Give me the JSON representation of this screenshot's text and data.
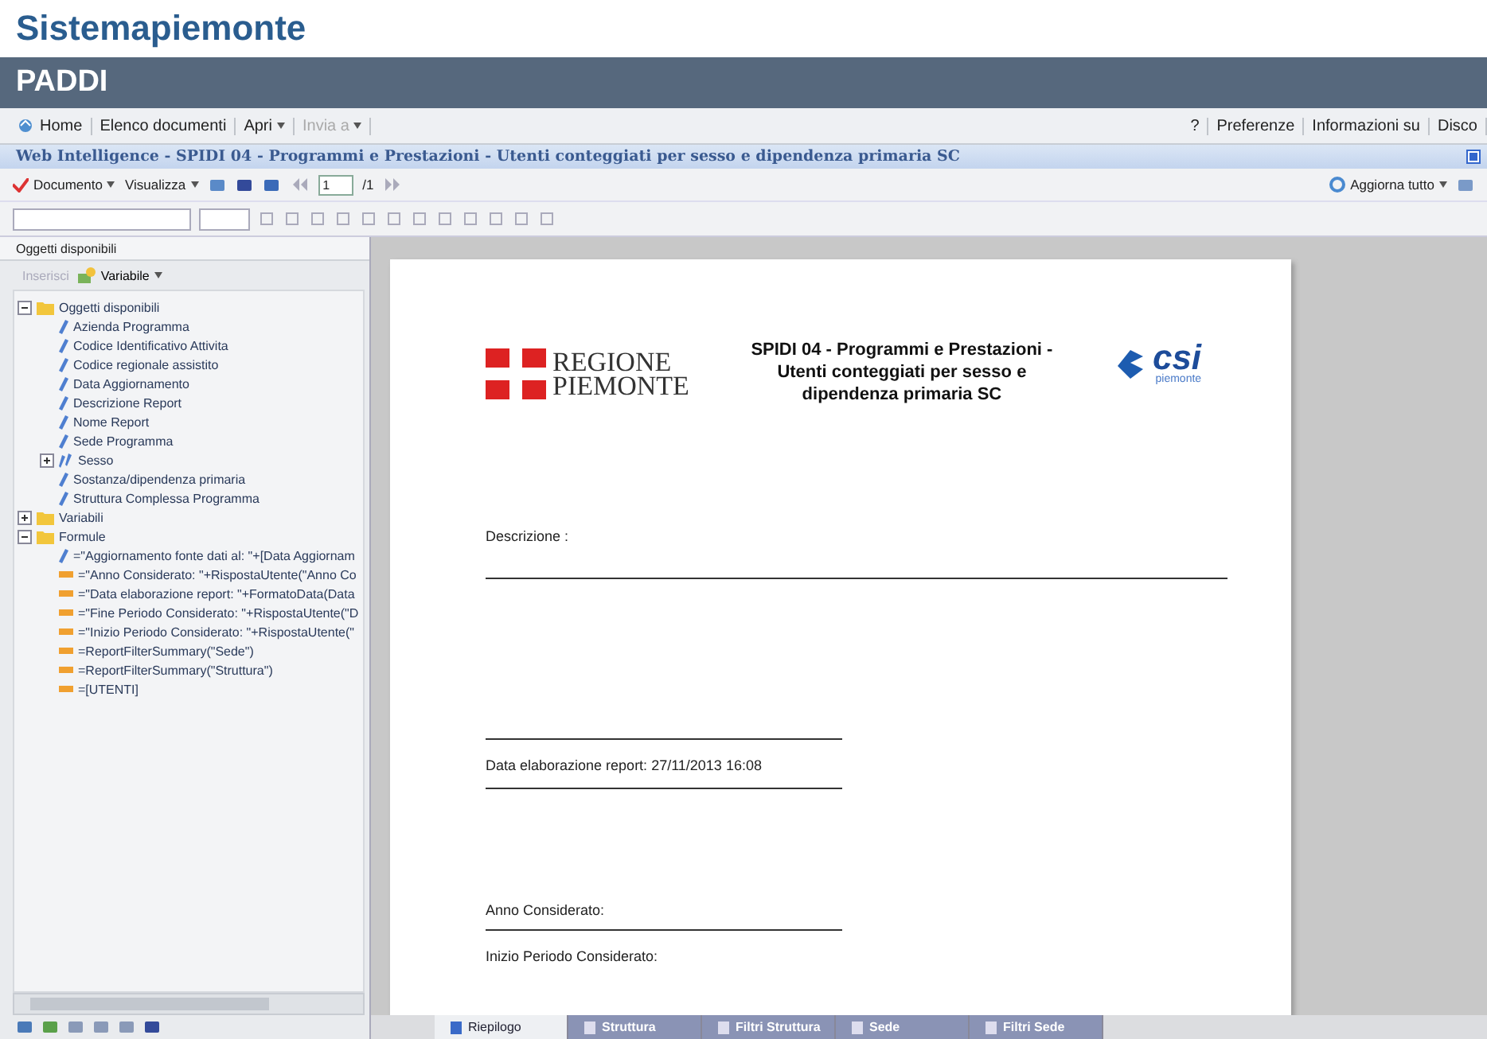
{
  "site_title": "Sistemapiemonte",
  "app_banner": "PADDI",
  "menu": {
    "left": [
      {
        "label": "Home",
        "kind": "home",
        "disabled": false
      },
      {
        "label": "Elenco documenti",
        "kind": "plain",
        "disabled": false
      },
      {
        "label": "Apri",
        "kind": "dropdown",
        "disabled": false
      },
      {
        "label": "Invia a",
        "kind": "dropdown",
        "disabled": true
      }
    ],
    "right": [
      "?",
      "Preferenze",
      "Informazioni su",
      "Disco"
    ]
  },
  "document_title": "Web Intelligence - SPIDI 04 - Programmi e Prestazioni - Utenti conteggiati per sesso e dipendenza primaria SC",
  "toolbar": {
    "document": "Documento",
    "view": "Visualizza",
    "page": "1",
    "page_count": "/1",
    "refresh": "Aggiorna tutto"
  },
  "left_panel": {
    "title": "Oggetti disponibili",
    "insert": "Inserisci",
    "variable": "Variabile",
    "tree": [
      {
        "label": "Oggetti disponibili",
        "kind": "folder",
        "expanded": true,
        "children": [
          {
            "label": "Azienda Programma",
            "kind": "dimension"
          },
          {
            "label": "Codice Identificativo Attivita",
            "kind": "dimension"
          },
          {
            "label": "Codice regionale assistito",
            "kind": "dimension"
          },
          {
            "label": "Data Aggiornamento",
            "kind": "dimension"
          },
          {
            "label": "Descrizione Report",
            "kind": "dimension"
          },
          {
            "label": "Nome Report",
            "kind": "dimension"
          },
          {
            "label": "Sede Programma",
            "kind": "dimension"
          },
          {
            "label": "Sesso",
            "kind": "hierarchy",
            "expanded": false
          },
          {
            "label": "Sostanza/dipendenza primaria",
            "kind": "dimension"
          },
          {
            "label": "Struttura Complessa Programma",
            "kind": "dimension"
          }
        ]
      },
      {
        "label": "Variabili",
        "kind": "folder",
        "expanded": false
      },
      {
        "label": "Formule",
        "kind": "folder",
        "expanded": true,
        "children": [
          {
            "label": "=\"Aggiornamento fonte dati al: \"+[Data Aggiornam",
            "kind": "dimension"
          },
          {
            "label": "=\"Anno Considerato: \"+RispostaUtente(\"Anno Co",
            "kind": "formula"
          },
          {
            "label": "=\"Data elaborazione report: \"+FormatoData(Data",
            "kind": "formula"
          },
          {
            "label": "=\"Fine Periodo Considerato: \"+RispostaUtente(\"D",
            "kind": "formula"
          },
          {
            "label": "=\"Inizio Periodo Considerato: \"+RispostaUtente(\"",
            "kind": "formula"
          },
          {
            "label": "=ReportFilterSummary(\"Sede\")",
            "kind": "formula"
          },
          {
            "label": "=ReportFilterSummary(\"Struttura\")",
            "kind": "formula"
          },
          {
            "label": "=[UTENTI]",
            "kind": "formula"
          }
        ]
      }
    ]
  },
  "report": {
    "logo_left": [
      "REGIONE",
      "PIEMONTE"
    ],
    "title": "SPIDI 04 - Programmi e Prestazioni - Utenti conteggiati per sesso e dipendenza primaria SC",
    "logo_right": {
      "name": "csi",
      "sub": "piemonte"
    },
    "fields": [
      {
        "label": "Descrizione :",
        "kind": "description"
      },
      {
        "label": "Data elaborazione report: 27/11/2013 16:08",
        "kind": "boxed"
      },
      {
        "label": "Anno Considerato:",
        "kind": "underlined"
      },
      {
        "label": "Inizio Periodo Considerato:",
        "kind": "plain"
      }
    ]
  },
  "report_tabs": [
    {
      "label": "Riepilogo",
      "selected": true
    },
    {
      "label": "Struttura",
      "selected": false
    },
    {
      "label": "Filtri Struttura",
      "selected": false
    },
    {
      "label": "Sede",
      "selected": false
    },
    {
      "label": "Filtri Sede",
      "selected": false
    }
  ]
}
